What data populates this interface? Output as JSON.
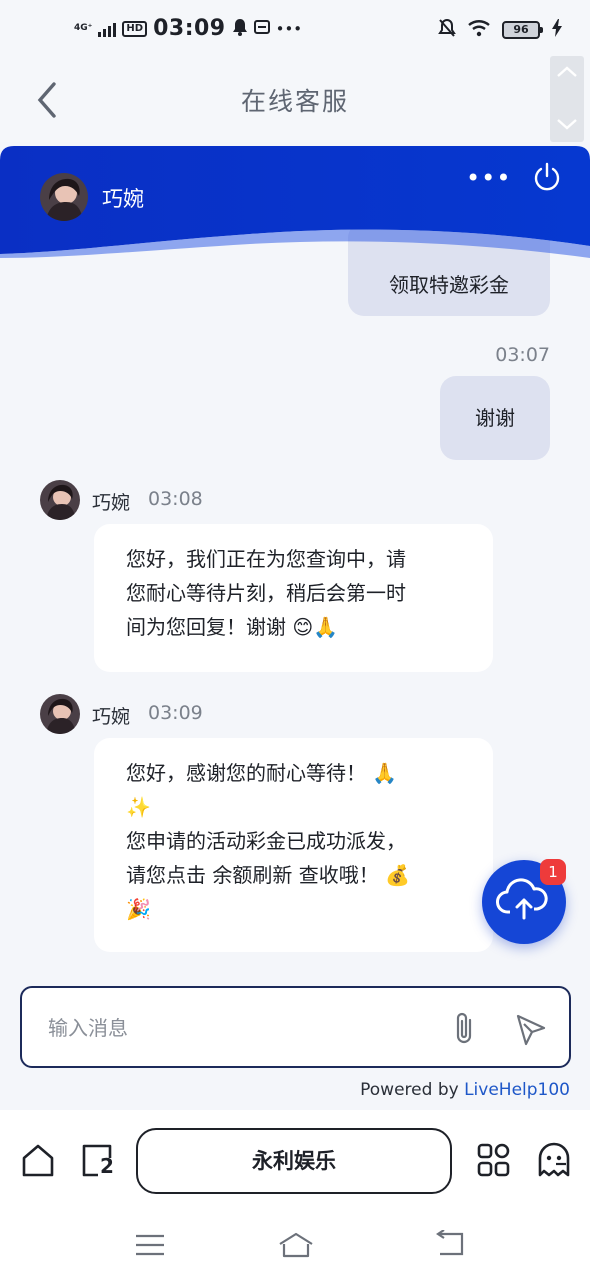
{
  "status_bar": {
    "network": "4G⁺",
    "hd": "HD",
    "time": "03:09",
    "more": "•••",
    "battery": "96"
  },
  "nav": {
    "title": "在线客服"
  },
  "agent": {
    "name": "巧婉",
    "more_label": "•••"
  },
  "messages": [
    {
      "type": "user",
      "text": "领取特邀彩金"
    },
    {
      "type": "timestamp",
      "text": "03:07"
    },
    {
      "type": "user",
      "text": "谢谢"
    },
    {
      "type": "agent",
      "sender": "巧婉",
      "time": "03:08",
      "lines": [
        "您好，我们正在为您查询中，请",
        "您耐心等待片刻，稍后会第一时",
        "间为您回复！谢谢"
      ],
      "emoji": "😊🙏"
    },
    {
      "type": "agent",
      "sender": "巧婉",
      "time": "03:09",
      "lines": [
        "您好，感谢您的耐心等待！",
        "您申请的活动彩金已成功派发，",
        "请您点击 余额刷新 查收哦！"
      ],
      "emoji_1": "🙏",
      "emoji_2": "✨",
      "emoji_3": "💰",
      "emoji_4": "🎉"
    }
  ],
  "upload_badge": "1",
  "composer": {
    "placeholder": "输入消息"
  },
  "powered_by": {
    "prefix": "Powered by ",
    "brand": "LiveHelp100"
  },
  "toolbar": {
    "tab_count": "2",
    "main_label": "永利娱乐"
  },
  "colors": {
    "header_blue": "#0633c8",
    "accent_blue": "#1546d6",
    "badge_red": "#ee3b3b",
    "user_bubble": "#dde1f0"
  }
}
